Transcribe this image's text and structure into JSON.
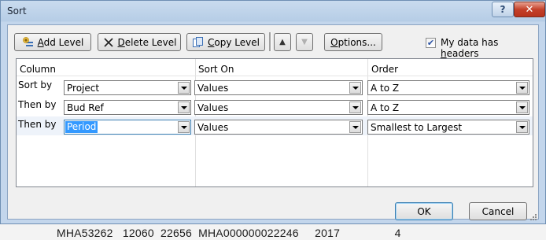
{
  "background_text": "MHA53262   12060  22656  MHA000000022246     2017                 4",
  "window": {
    "title": "Sort",
    "help_glyph": "?",
    "close_glyph": "✕"
  },
  "toolbar": {
    "add_level": {
      "pre": "",
      "u": "A",
      "post": "dd Level"
    },
    "delete_level": {
      "pre": "",
      "u": "D",
      "post": "elete Level"
    },
    "copy_level": {
      "pre": "",
      "u": "C",
      "post": "opy Level"
    },
    "move_up_glyph": "▲",
    "move_down_glyph": "▼",
    "options": {
      "pre": "",
      "u": "O",
      "post": "ptions..."
    },
    "headers_checkbox": {
      "checked": true,
      "label_pre": "My data has ",
      "label_u": "h",
      "label_post": "eaders"
    }
  },
  "grid": {
    "headers": {
      "column": "Column",
      "sort_on": "Sort On",
      "order": "Order"
    },
    "rows": [
      {
        "label": "Sort by",
        "column": "Project",
        "sort_on": "Values",
        "order": "A to Z",
        "selected": false
      },
      {
        "label": "Then by",
        "column": "Bud Ref",
        "sort_on": "Values",
        "order": "A to Z",
        "selected": false
      },
      {
        "label": "Then by",
        "column": "Period",
        "sort_on": "Values",
        "order": "Smallest to Largest",
        "selected": true
      }
    ]
  },
  "footer": {
    "ok": "OK",
    "cancel": "Cancel"
  },
  "colors": {
    "titlebar": "#c9dbee",
    "close_button": "#c4412a",
    "selection": "#3399ff"
  }
}
